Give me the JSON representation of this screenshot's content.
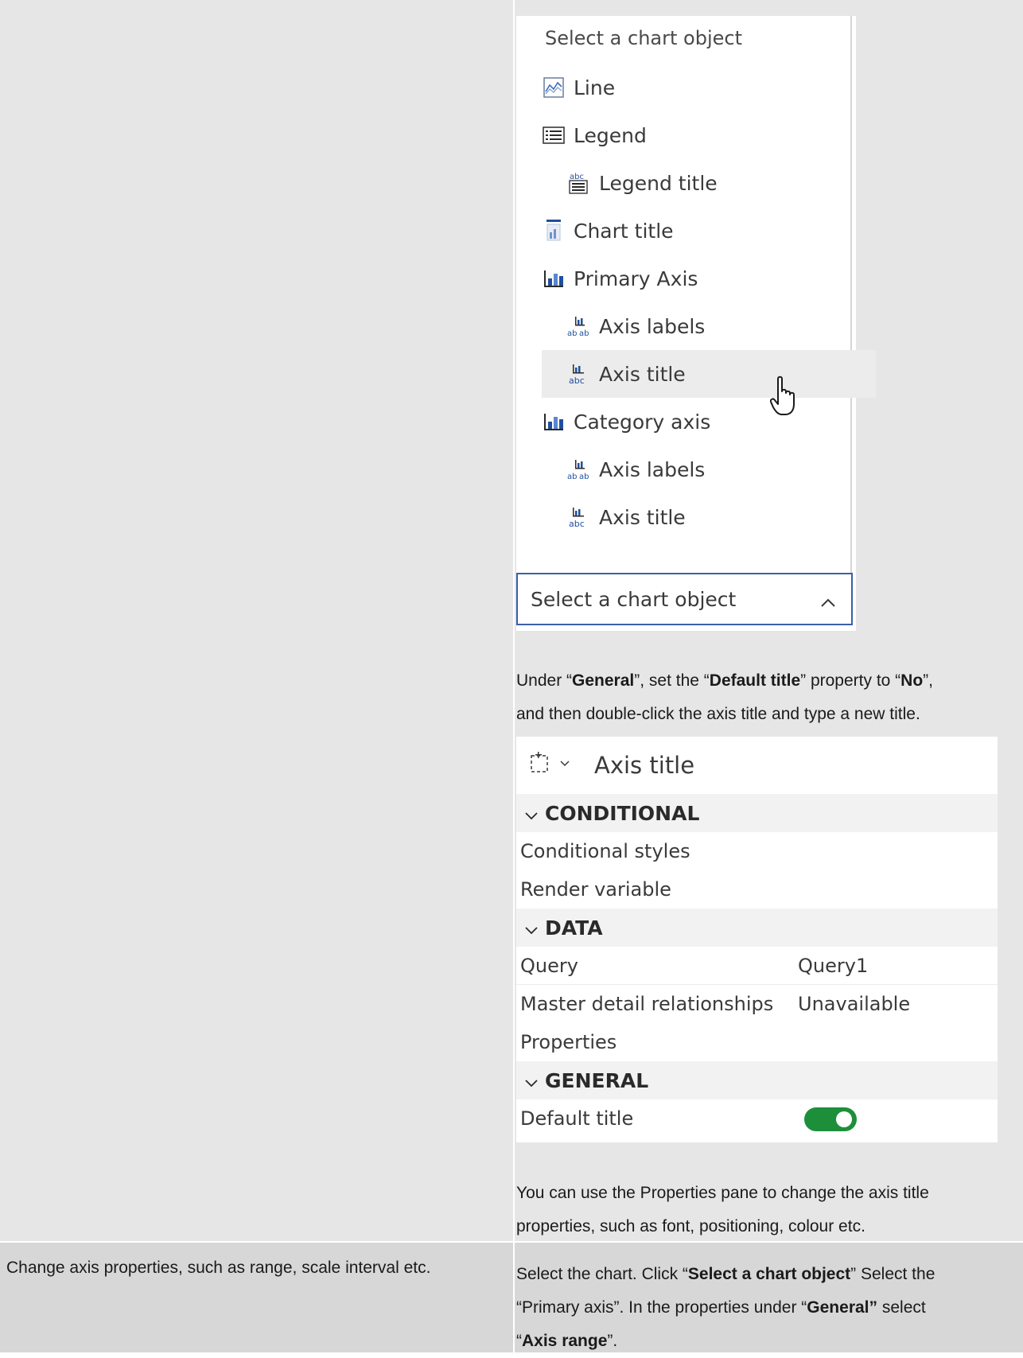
{
  "menu": {
    "header": "Select a chart object",
    "items": [
      {
        "label": "Line",
        "icon": "line-chart-icon",
        "level": 1
      },
      {
        "label": "Legend",
        "icon": "legend-icon",
        "level": 1
      },
      {
        "label": "Legend title",
        "icon": "legend-title-icon",
        "level": 2
      },
      {
        "label": "Chart title",
        "icon": "chart-title-icon",
        "level": 1
      },
      {
        "label": "Primary Axis",
        "icon": "bar-chart-icon",
        "level": 1
      },
      {
        "label": "Axis labels",
        "icon": "axis-labels-icon",
        "level": 2
      },
      {
        "label": "Axis title",
        "icon": "axis-title-icon",
        "level": 2
      },
      {
        "label": "Category axis",
        "icon": "bar-chart-icon",
        "level": 1
      },
      {
        "label": "Axis labels",
        "icon": "axis-labels-icon",
        "level": 2
      },
      {
        "label": "Axis title",
        "icon": "axis-title-icon",
        "level": 2
      }
    ],
    "select_value": "Select a chart object"
  },
  "instruction1": {
    "p1": "Under “",
    "b1": "General",
    "p2": "”, set the “",
    "b2": "Default title",
    "p3": "” property to “",
    "b3": "No",
    "p4": "”,",
    "line2": "and then double-click the axis title and type a new title."
  },
  "properties": {
    "title": "Axis title",
    "sections": {
      "conditional": "CONDITIONAL",
      "data": "DATA",
      "general": "GENERAL"
    },
    "rows": {
      "conditional_styles": "Conditional styles",
      "render_variable": "Render variable",
      "query": "Query",
      "query_value": "Query1",
      "master_detail": "Master detail relationships",
      "master_detail_value": "Unavailable",
      "properties": "Properties",
      "default_title": "Default title"
    },
    "default_title_on": true
  },
  "instruction2": {
    "line1": "You can use the Properties pane to change the axis title",
    "line2": "properties, such as font, positioning, colour etc."
  },
  "row2": {
    "left": "Change axis properties, such as range, scale interval etc.",
    "r1a": "Select the chart. Click “",
    "r1b": "Select a chart object",
    "r1c": "” Select the",
    "r2a": "“Primary axis”. In the properties under “",
    "r2b": "General”",
    "r2c": " select",
    "r3a": "“",
    "r3b": "Axis range",
    "r3c": "”."
  },
  "colors": {
    "accent_border": "#3c5fa8",
    "toggle_on": "#1d8f3b",
    "icon_blue": "#1f4f9e"
  }
}
